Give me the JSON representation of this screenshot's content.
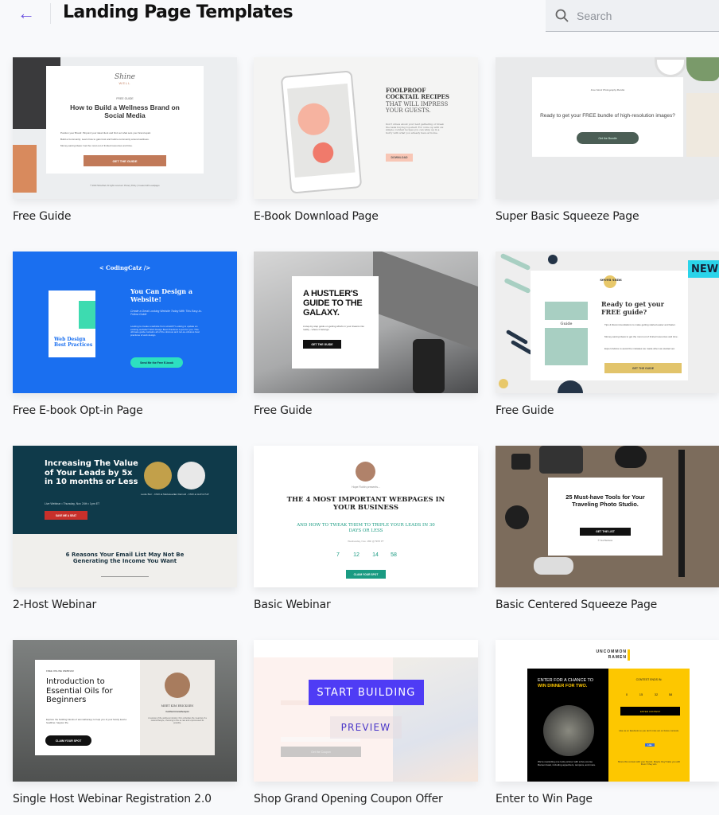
{
  "header": {
    "title": "Landing Page Templates",
    "back_icon": "arrow-left-icon",
    "search_placeholder": "Search",
    "search_icon": "search-icon"
  },
  "colors": {
    "accent": "#6a4fe0",
    "start_building": "#4f3cf5"
  },
  "templates": [
    {
      "name": "Free Guide",
      "logo_line1": "Shine",
      "logo_line2": "WELL",
      "eyebrow": "FREE GUIDE",
      "title": "How to Build a Wellness Brand on Social Media",
      "bullets": [
        "Position your Brand: Pinpoint your ideal client and find out what sets your brand apart.",
        "Build a Community: Learn how to gain trust and build a community around wellness.",
        "Money-saving Ideas: Get the most out of limited resources and time."
      ],
      "button": "GET THE GUIDE",
      "footer": "© 2020 ShineWell. All rights reserved. Privacy Policy | Created with Leadpages"
    },
    {
      "name": "E-Book Download Page",
      "title_bold": "FOOLPROOF COCKTAIL RECIPES",
      "title_light": "THAT WILL IMPRESS YOUR GUESTS.",
      "body": "Don't stress about your next gathering or break the bank buying top-shelf. For come up with six simple cocktail recipes you can whip up in a hurry with what you already have at home.",
      "button": "DOWNLOAD"
    },
    {
      "name": "Super Basic Squeeze Page",
      "eyebrow": "Free Stock Photography Bundle",
      "title": "Ready to get your FREE bundle of high-resolution images?",
      "button": "Get the Bundle"
    },
    {
      "name": "Free E-book Opt-in Page",
      "logo": "< CodingCatz />",
      "book_title": "Web Design Best Practices",
      "title": "You Can Design a Website!",
      "subtitle": "Create a Great Looking Website Today With This Easy-to-Follow Guide",
      "body": "Looking to create a website from scratch? Looking to update an existing website? Web Design Best Practices is just for you. This ultimate guide contains all of the obvious and not-so-obvious best practices of web design.",
      "button": "Send Me the Free E-book"
    },
    {
      "name": "Free Guide",
      "title": "A HUSTLER'S GUIDE TO THE GALAXY.",
      "body": "A step-by-step guide on getting what's in your dreams into reality - where it belongs.",
      "button": "GET THE GUIDE"
    },
    {
      "name": "Free Guide",
      "badge": "NEW",
      "logo": "seven suns",
      "book_label": "Guide",
      "title": "Ready to get your FREE guide?",
      "bullets": [
        "Tips & Recommendations to make getting started easier and faster.",
        "Money-saving Ideas to get the most out of limited resources and time.",
        "Expert Advice to avoid the mistakes we made when we started out."
      ],
      "button": "GET THE GUIDE"
    },
    {
      "name": "2-Host Webinar",
      "title": "Increasing The Value of Your Leads by 5x in 10 months or Less",
      "date": "Live Webinar • Thursday, Nov 24th • 1pm ET",
      "button": "SAVE ME A SEAT",
      "host1": "Leslie Burr - CMO at Marketeers",
      "host2": "Ian Darnold - CMO at Huff & Puff",
      "subtitle": "6 Reasons Your Email List May Not Be Generating the Income You Want"
    },
    {
      "name": "Basic Webinar",
      "presenter": "Hope Robin presents...",
      "title": "THE 4 MOST IMPORTANT WEBPAGES IN YOUR BUSINESS",
      "subtitle": "AND HOW TO TWEAK THEM TO TRIPLE YOUR LEADS IN 30 DAYS OR LESS",
      "date": "Wednesday, Nov. 18th @ 5PM PT",
      "countdown": [
        "7",
        "12",
        "14",
        "58"
      ],
      "button": "CLAIM YOUR SPOT"
    },
    {
      "name": "Basic Centered Squeeze Page",
      "title": "25 Must-have Tools for Your Traveling Photo Studio.",
      "button": "GET THE LIST",
      "footer": "© Your Business"
    },
    {
      "name": "Single Host Webinar Registration 2.0",
      "eyebrow": "FREE ONLINE WEBINAR",
      "title": "Introduction to Essential Oils for Beginners",
      "body": "Explore the building blocks of aromatherapy to help you & your family lead a healthier, happier life.",
      "button": "CLAIM YOUR SPOT",
      "host_name": "MEET KIM ERICKSEN",
      "host_role": "Certified Aromatherapist",
      "host_bio": "A veteran of the wellness industry, Kim embodies the meaning of a natural lifestyle, choosing to live as raw and unprocessed as possible."
    },
    {
      "name": "Shop Grand Opening Coupon Offer",
      "hover_primary": "START BUILDING",
      "hover_secondary": "PREVIEW",
      "button": "Get the Coupon"
    },
    {
      "name": "Enter to Win Page",
      "logo_line1": "UNCOMMON",
      "logo_line2": "RAMEN",
      "title_plain": "ENTER FOR A CHANCE TO ",
      "title_accent": "WIN DINNER FOR TWO.",
      "contest_label": "CONTEST ENDS IN:",
      "countdown": [
        "0",
        "15",
        "32",
        "58"
      ],
      "button": "ENTER CONTEST",
      "facebook_text": "Like us on facebook so you don't miss out on future contests.",
      "like_button": "Like",
      "share_text": "Share this contest with your friends. Maybe they'll take you with them if they win.",
      "body": "We're rewarding one lucky winner with a five-course Ramen feast, including appetizers, tempura, and more."
    }
  ]
}
